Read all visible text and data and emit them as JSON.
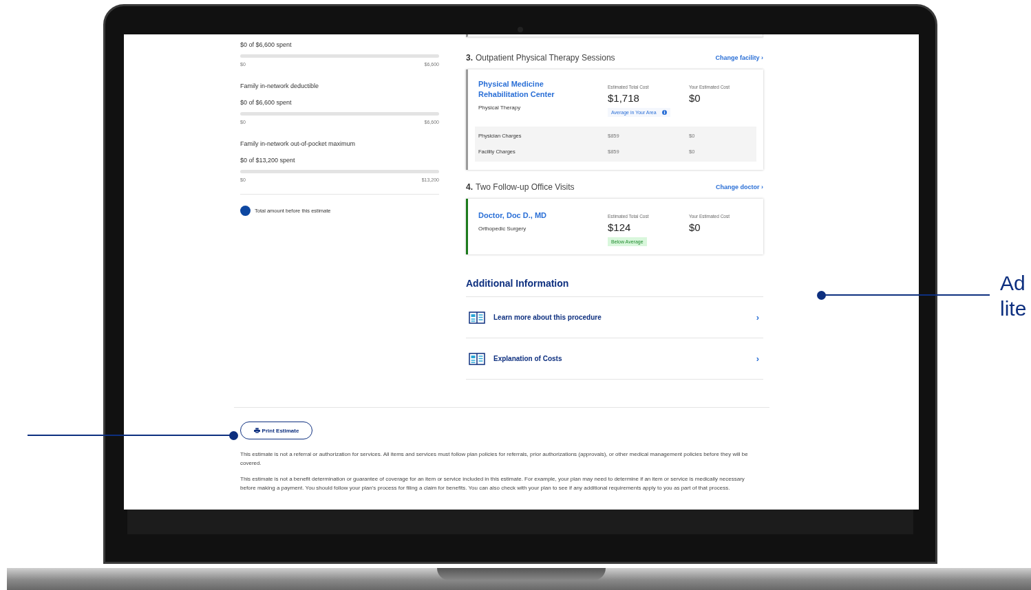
{
  "meters": [
    {
      "spent": "$0 of $6,600 spent",
      "level": 0,
      "min": "$0",
      "max": "$6,600"
    },
    {
      "label": "Family in-network deductible",
      "spent": "$0 of $6,600 spent",
      "level": 0,
      "min": "$0",
      "max": "$6,600"
    },
    {
      "label": "Family in-network out-of-pocket maximum",
      "spent": "$0 of $13,200 spent",
      "level": 0,
      "min": "$0",
      "max": "$13,200"
    }
  ],
  "legend": {
    "color": "#0d47a1",
    "text": "Total amount before this estimate"
  },
  "services": [
    {
      "number": "3.",
      "title": "Outpatient Physical Therapy Sessions",
      "change_link": "Change facility",
      "chevron": "›",
      "provider": "Physical Medicine Rehabilitation Center",
      "specialty": "Physical Therapy",
      "total_label": "Estimated Total Cost",
      "total": "$1,718",
      "badge": {
        "kind": "average",
        "text": "Average in Your Area"
      },
      "your_label": "Your Estimated Cost",
      "your_cost": "$0",
      "charges": [
        {
          "name": "Physician Charges",
          "total": "$859",
          "yours": "$0"
        },
        {
          "name": "Facility Charges",
          "total": "$859",
          "yours": "$0"
        }
      ]
    },
    {
      "number": "4.",
      "title": "Two Follow-up Office Visits",
      "change_link": "Change doctor",
      "chevron": "›",
      "provider": "Doctor, Doc D., MD",
      "specialty": "Orthopedic Surgery",
      "total_label": "Estimated Total Cost",
      "total": "$124",
      "badge": {
        "kind": "below",
        "text": "Below Average"
      },
      "your_label": "Your Estimated Cost",
      "your_cost": "$0"
    }
  ],
  "additional_info": {
    "heading": "Additional Information",
    "links": [
      {
        "text": "Learn more about this procedure",
        "chevron": "›"
      },
      {
        "text": "Explanation of Costs",
        "chevron": "›"
      }
    ]
  },
  "print_button": "Print Estimate",
  "disclaimers": [
    "This estimate is not a referral or authorization for services. All items and services must follow plan policies for referrals, prior authorizations (approvals), or other medical management policies before they will be covered.",
    "This estimate is not a benefit determination or guarantee of coverage for an item or service included in this estimate. For example, your plan may need to determine if an item or service is medically necessary before making a payment. You should follow your plan’s process for filing a claim for benefits. You can also check with your plan to see if any additional requirements apply to you as part of that process."
  ],
  "callout_text": "Ad lite"
}
